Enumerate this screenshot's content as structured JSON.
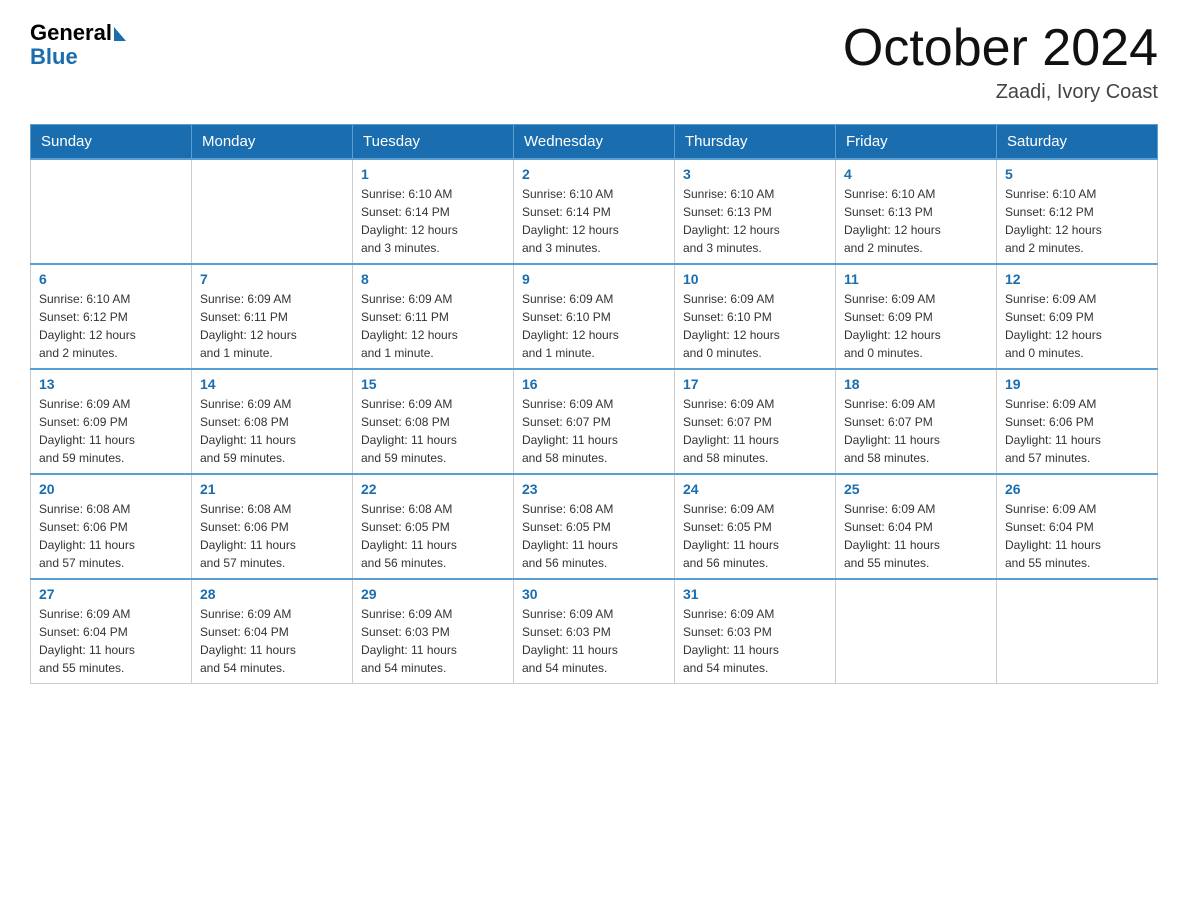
{
  "header": {
    "logo_general": "General",
    "logo_blue": "Blue",
    "title": "October 2024",
    "location": "Zaadi, Ivory Coast"
  },
  "calendar": {
    "days_of_week": [
      "Sunday",
      "Monday",
      "Tuesday",
      "Wednesday",
      "Thursday",
      "Friday",
      "Saturday"
    ],
    "weeks": [
      [
        {
          "day": "",
          "info": ""
        },
        {
          "day": "",
          "info": ""
        },
        {
          "day": "1",
          "info": "Sunrise: 6:10 AM\nSunset: 6:14 PM\nDaylight: 12 hours\nand 3 minutes."
        },
        {
          "day": "2",
          "info": "Sunrise: 6:10 AM\nSunset: 6:14 PM\nDaylight: 12 hours\nand 3 minutes."
        },
        {
          "day": "3",
          "info": "Sunrise: 6:10 AM\nSunset: 6:13 PM\nDaylight: 12 hours\nand 3 minutes."
        },
        {
          "day": "4",
          "info": "Sunrise: 6:10 AM\nSunset: 6:13 PM\nDaylight: 12 hours\nand 2 minutes."
        },
        {
          "day": "5",
          "info": "Sunrise: 6:10 AM\nSunset: 6:12 PM\nDaylight: 12 hours\nand 2 minutes."
        }
      ],
      [
        {
          "day": "6",
          "info": "Sunrise: 6:10 AM\nSunset: 6:12 PM\nDaylight: 12 hours\nand 2 minutes."
        },
        {
          "day": "7",
          "info": "Sunrise: 6:09 AM\nSunset: 6:11 PM\nDaylight: 12 hours\nand 1 minute."
        },
        {
          "day": "8",
          "info": "Sunrise: 6:09 AM\nSunset: 6:11 PM\nDaylight: 12 hours\nand 1 minute."
        },
        {
          "day": "9",
          "info": "Sunrise: 6:09 AM\nSunset: 6:10 PM\nDaylight: 12 hours\nand 1 minute."
        },
        {
          "day": "10",
          "info": "Sunrise: 6:09 AM\nSunset: 6:10 PM\nDaylight: 12 hours\nand 0 minutes."
        },
        {
          "day": "11",
          "info": "Sunrise: 6:09 AM\nSunset: 6:09 PM\nDaylight: 12 hours\nand 0 minutes."
        },
        {
          "day": "12",
          "info": "Sunrise: 6:09 AM\nSunset: 6:09 PM\nDaylight: 12 hours\nand 0 minutes."
        }
      ],
      [
        {
          "day": "13",
          "info": "Sunrise: 6:09 AM\nSunset: 6:09 PM\nDaylight: 11 hours\nand 59 minutes."
        },
        {
          "day": "14",
          "info": "Sunrise: 6:09 AM\nSunset: 6:08 PM\nDaylight: 11 hours\nand 59 minutes."
        },
        {
          "day": "15",
          "info": "Sunrise: 6:09 AM\nSunset: 6:08 PM\nDaylight: 11 hours\nand 59 minutes."
        },
        {
          "day": "16",
          "info": "Sunrise: 6:09 AM\nSunset: 6:07 PM\nDaylight: 11 hours\nand 58 minutes."
        },
        {
          "day": "17",
          "info": "Sunrise: 6:09 AM\nSunset: 6:07 PM\nDaylight: 11 hours\nand 58 minutes."
        },
        {
          "day": "18",
          "info": "Sunrise: 6:09 AM\nSunset: 6:07 PM\nDaylight: 11 hours\nand 58 minutes."
        },
        {
          "day": "19",
          "info": "Sunrise: 6:09 AM\nSunset: 6:06 PM\nDaylight: 11 hours\nand 57 minutes."
        }
      ],
      [
        {
          "day": "20",
          "info": "Sunrise: 6:08 AM\nSunset: 6:06 PM\nDaylight: 11 hours\nand 57 minutes."
        },
        {
          "day": "21",
          "info": "Sunrise: 6:08 AM\nSunset: 6:06 PM\nDaylight: 11 hours\nand 57 minutes."
        },
        {
          "day": "22",
          "info": "Sunrise: 6:08 AM\nSunset: 6:05 PM\nDaylight: 11 hours\nand 56 minutes."
        },
        {
          "day": "23",
          "info": "Sunrise: 6:08 AM\nSunset: 6:05 PM\nDaylight: 11 hours\nand 56 minutes."
        },
        {
          "day": "24",
          "info": "Sunrise: 6:09 AM\nSunset: 6:05 PM\nDaylight: 11 hours\nand 56 minutes."
        },
        {
          "day": "25",
          "info": "Sunrise: 6:09 AM\nSunset: 6:04 PM\nDaylight: 11 hours\nand 55 minutes."
        },
        {
          "day": "26",
          "info": "Sunrise: 6:09 AM\nSunset: 6:04 PM\nDaylight: 11 hours\nand 55 minutes."
        }
      ],
      [
        {
          "day": "27",
          "info": "Sunrise: 6:09 AM\nSunset: 6:04 PM\nDaylight: 11 hours\nand 55 minutes."
        },
        {
          "day": "28",
          "info": "Sunrise: 6:09 AM\nSunset: 6:04 PM\nDaylight: 11 hours\nand 54 minutes."
        },
        {
          "day": "29",
          "info": "Sunrise: 6:09 AM\nSunset: 6:03 PM\nDaylight: 11 hours\nand 54 minutes."
        },
        {
          "day": "30",
          "info": "Sunrise: 6:09 AM\nSunset: 6:03 PM\nDaylight: 11 hours\nand 54 minutes."
        },
        {
          "day": "31",
          "info": "Sunrise: 6:09 AM\nSunset: 6:03 PM\nDaylight: 11 hours\nand 54 minutes."
        },
        {
          "day": "",
          "info": ""
        },
        {
          "day": "",
          "info": ""
        }
      ]
    ]
  }
}
